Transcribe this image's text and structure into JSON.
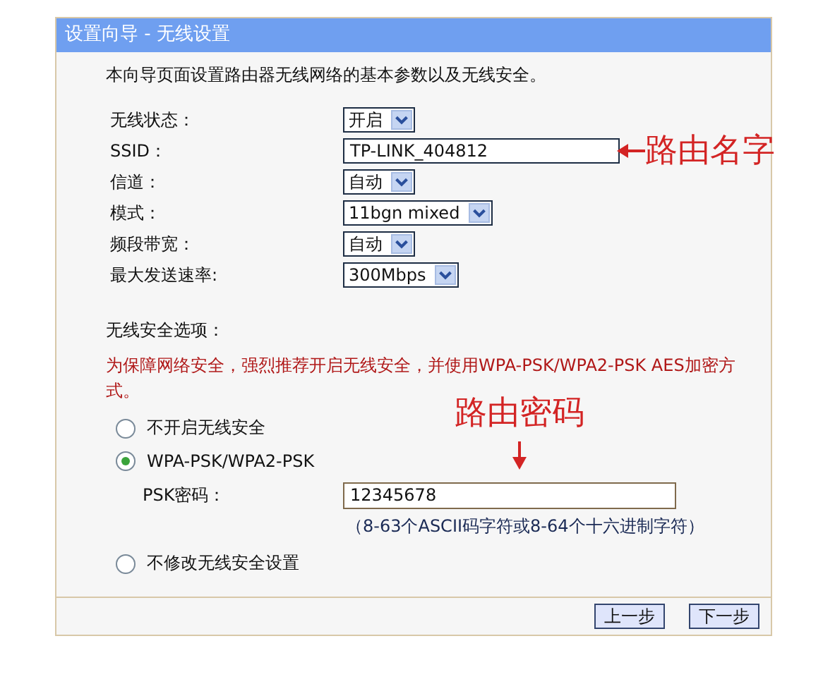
{
  "window": {
    "title": "设置向导 - 无线设置"
  },
  "intro": "本向导页面设置路由器无线网络的基本参数以及无线安全。",
  "fields": [
    {
      "label": "无线状态：",
      "kind": "select",
      "value": "开启"
    },
    {
      "label": "SSID：",
      "kind": "input",
      "value": "TP-LINK_404812"
    },
    {
      "label": "信道：",
      "kind": "select",
      "value": "自动"
    },
    {
      "label": "模式：",
      "kind": "select",
      "value": "11bgn mixed"
    },
    {
      "label": "频段带宽：",
      "kind": "select",
      "value": "自动"
    },
    {
      "label": "最大发送速率:",
      "kind": "select",
      "value": "300Mbps"
    }
  ],
  "security": {
    "heading": "无线安全选项：",
    "warning": "为保障网络安全，强烈推荐开启无线安全，并使用WPA-PSK/WPA2-PSK AES加密方式。",
    "options": [
      {
        "label": "不开启无线安全",
        "selected": false
      },
      {
        "label": "WPA-PSK/WPA2-PSK",
        "selected": true,
        "password": {
          "label": "PSK密码：",
          "value": "12345678",
          "hint": "（8-63个ASCII码字符或8-64个十六进制字符）"
        }
      },
      {
        "label": "不修改无线安全设置",
        "selected": false
      }
    ]
  },
  "buttons": [
    "上一步",
    "下一步"
  ],
  "annotations": [
    {
      "text": "路由名字",
      "kind": "left-arrow"
    },
    {
      "text": "路由密码",
      "kind": "down-arrow"
    }
  ]
}
